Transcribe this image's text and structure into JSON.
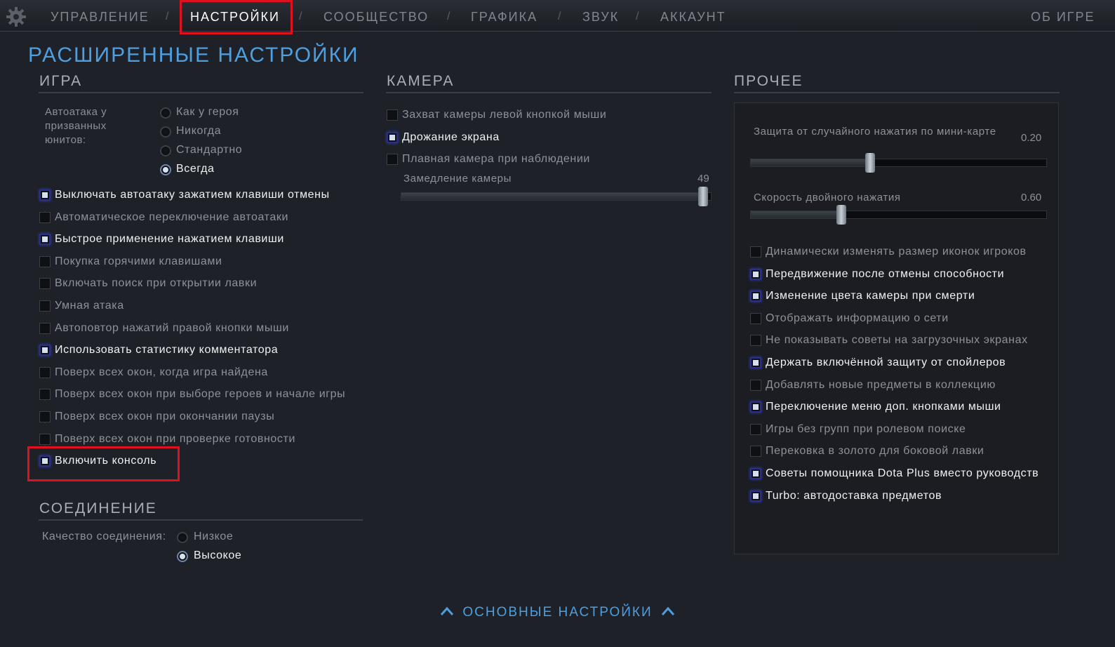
{
  "nav": {
    "tabs": [
      "УПРАВЛЕНИЕ",
      "НАСТРОЙКИ",
      "СООБЩЕСТВО",
      "ГРАФИКА",
      "ЗВУК",
      "АККАУНТ"
    ],
    "separator": "/",
    "active": "НАСТРОЙКИ",
    "about": "ОБ ИГРЕ"
  },
  "title": "РАСШИРЕННЫЕ НАСТРОЙКИ",
  "game": {
    "title": "ИГРА",
    "autoattack_label": "Автоатака у призванных юнитов:",
    "autoattack_options": [
      "Как у героя",
      "Никогда",
      "Стандартно",
      "Всегда"
    ],
    "autoattack_selected": "Всегда",
    "checkboxes": [
      {
        "label": "Выключать автоатаку зажатием клавиши отмены",
        "checked": true
      },
      {
        "label": "Автоматическое переключение автоатаки",
        "checked": false
      },
      {
        "label": "Быстрое применение нажатием клавиши",
        "checked": true
      },
      {
        "label": "Покупка горячими клавишами",
        "checked": false
      },
      {
        "label": "Включать поиск при открытии лавки",
        "checked": false
      },
      {
        "label": "Умная атака",
        "checked": false
      },
      {
        "label": "Автоповтор нажатий правой кнопки мыши",
        "checked": false
      },
      {
        "label": "Использовать статистику комментатора",
        "checked": true
      },
      {
        "label": "Поверх всех окон, когда игра найдена",
        "checked": false
      },
      {
        "label": "Поверх всех окон при выборе героев и начале игры",
        "checked": false
      },
      {
        "label": "Поверх всех окон при окончании паузы",
        "checked": false
      },
      {
        "label": "Поверх всех окон при проверке готовности",
        "checked": false
      },
      {
        "label": "Включить консоль",
        "checked": true
      }
    ]
  },
  "connection": {
    "title": "СОЕДИНЕНИЕ",
    "quality_label": "Качество соединения:",
    "options": [
      "Низкое",
      "Высокое"
    ],
    "selected": "Высокое"
  },
  "camera": {
    "title": "КАМЕРА",
    "checkboxes": [
      {
        "label": "Захват камеры левой кнопкой мыши",
        "checked": false
      },
      {
        "label": "Дрожание экрана",
        "checked": true
      },
      {
        "label": "Плавная камера при наблюдении",
        "checked": false
      }
    ],
    "slowdown_label": "Замедление камеры",
    "slowdown_value": "49",
    "slowdown_fraction": 0.99
  },
  "other": {
    "title": "ПРОЧЕЕ",
    "minimap_label": "Защита от случайного нажатия по мини-карте",
    "minimap_value": "0.20",
    "minimap_fraction": 0.4,
    "doubletap_label": "Скорость двойного нажатия",
    "doubletap_value": "0.60",
    "doubletap_fraction": 0.3,
    "checkboxes": [
      {
        "label": "Динамически изменять размер иконок игроков",
        "checked": false
      },
      {
        "label": "Передвижение после отмены способности",
        "checked": true
      },
      {
        "label": "Изменение цвета камеры при смерти",
        "checked": true
      },
      {
        "label": "Отображать информацию о сети",
        "checked": false
      },
      {
        "label": "Не показывать советы на загрузочных экранах",
        "checked": false
      },
      {
        "label": "Держать включённой защиту от спойлеров",
        "checked": true
      },
      {
        "label": "Добавлять новые предметы в коллекцию",
        "checked": false
      },
      {
        "label": "Переключение меню доп. кнопками мыши",
        "checked": true
      },
      {
        "label": "Игры без групп при ролевом поиске",
        "checked": false
      },
      {
        "label": "Перековка в золото для боковой лавки",
        "checked": false
      },
      {
        "label": "Советы помощника Dota Plus вместо руководств",
        "checked": true
      },
      {
        "label": "Turbo: автодоставка предметов",
        "checked": true
      }
    ]
  },
  "bottom_link": "ОСНОВНЫЕ НАСТРОЙКИ"
}
